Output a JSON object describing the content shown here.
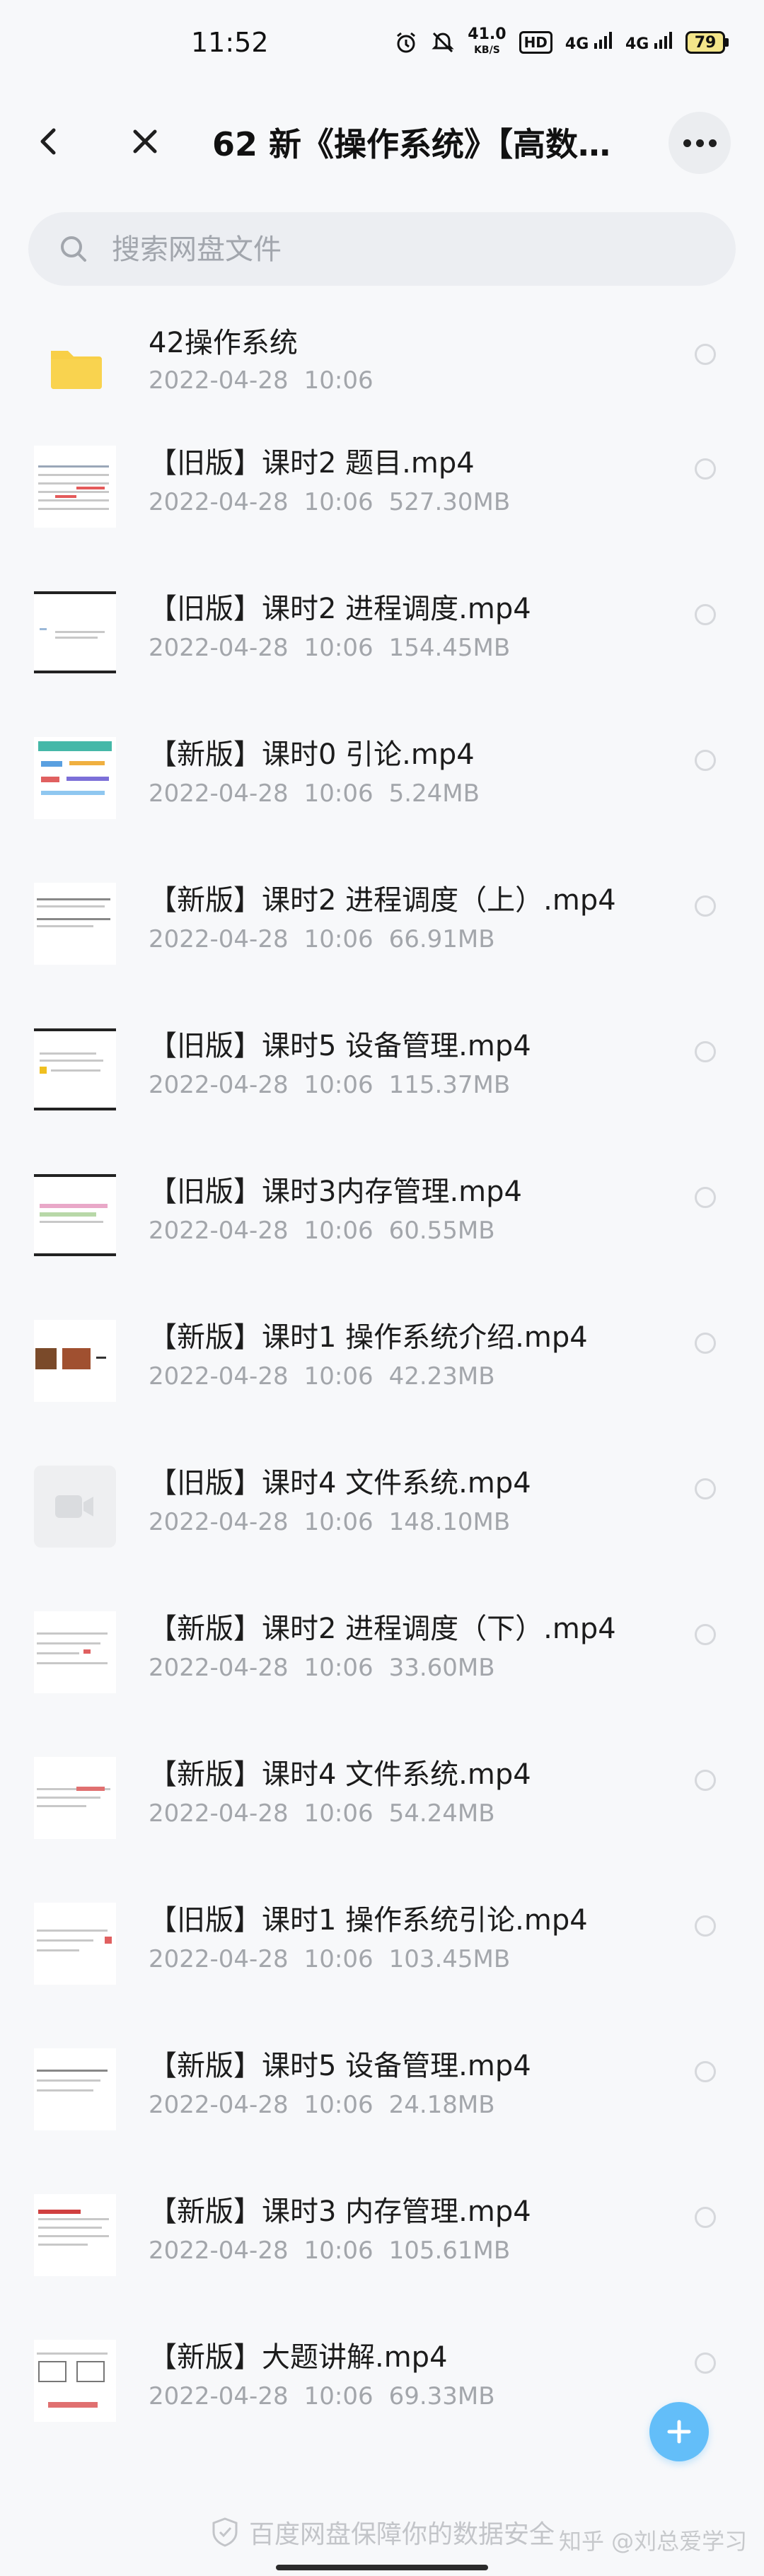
{
  "status_bar": {
    "time": "11:52",
    "net_speed_value": "41.0",
    "net_speed_unit": "KB/S",
    "hd_badge": "HD",
    "signal_1": "4G",
    "signal_2": "4G",
    "battery": "79",
    "icons": [
      "alarm-icon",
      "mute-icon",
      "signal-icon",
      "battery-icon"
    ]
  },
  "header": {
    "title": "62 新《操作系统》【高数…",
    "back_icon": "back-arrow-icon",
    "close_icon": "close-icon",
    "more_icon": "more-dots-icon"
  },
  "search": {
    "placeholder": "搜索网盘文件",
    "value": ""
  },
  "files": [
    {
      "name": "42操作系统",
      "date": "2022-04-28",
      "time": "10:06",
      "size": "",
      "type": "folder"
    },
    {
      "name": "【旧版】课时2 题目.mp4",
      "date": "2022-04-28",
      "time": "10:06",
      "size": "527.30MB",
      "type": "video"
    },
    {
      "name": "【旧版】课时2 进程调度.mp4",
      "date": "2022-04-28",
      "time": "10:06",
      "size": "154.45MB",
      "type": "video"
    },
    {
      "name": "【新版】课时0 引论.mp4",
      "date": "2022-04-28",
      "time": "10:06",
      "size": "5.24MB",
      "type": "video"
    },
    {
      "name": "【新版】课时2 进程调度（上）.mp4",
      "date": "2022-04-28",
      "time": "10:06",
      "size": "66.91MB",
      "type": "video"
    },
    {
      "name": "【旧版】课时5 设备管理.mp4",
      "date": "2022-04-28",
      "time": "10:06",
      "size": "115.37MB",
      "type": "video"
    },
    {
      "name": "【旧版】课时3内存管理.mp4",
      "date": "2022-04-28",
      "time": "10:06",
      "size": "60.55MB",
      "type": "video"
    },
    {
      "name": "【新版】课时1 操作系统介绍.mp4",
      "date": "2022-04-28",
      "time": "10:06",
      "size": "42.23MB",
      "type": "video"
    },
    {
      "name": "【旧版】课时4 文件系统.mp4",
      "date": "2022-04-28",
      "time": "10:06",
      "size": "148.10MB",
      "type": "video"
    },
    {
      "name": "【新版】课时2 进程调度（下）.mp4",
      "date": "2022-04-28",
      "time": "10:06",
      "size": "33.60MB",
      "type": "video"
    },
    {
      "name": "【新版】课时4 文件系统.mp4",
      "date": "2022-04-28",
      "time": "10:06",
      "size": "54.24MB",
      "type": "video"
    },
    {
      "name": "【旧版】课时1 操作系统引论.mp4",
      "date": "2022-04-28",
      "time": "10:06",
      "size": "103.45MB",
      "type": "video"
    },
    {
      "name": "【新版】课时5 设备管理.mp4",
      "date": "2022-04-28",
      "time": "10:06",
      "size": "24.18MB",
      "type": "video"
    },
    {
      "name": "【新版】课时3 内存管理.mp4",
      "date": "2022-04-28",
      "time": "10:06",
      "size": "105.61MB",
      "type": "video"
    },
    {
      "name": "【新版】大题讲解.mp4",
      "date": "2022-04-28",
      "time": "10:06",
      "size": "69.33MB",
      "type": "video"
    }
  ],
  "fab": {
    "icon": "plus-icon"
  },
  "footer": {
    "note": "百度网盘保障你的数据安全",
    "watermark": "知乎 @刘总爱学习"
  },
  "colors": {
    "accent": "#63bef9",
    "folder": "#f8cf47",
    "meta_text": "#a3a6ab",
    "background": "#f7f8fa"
  }
}
